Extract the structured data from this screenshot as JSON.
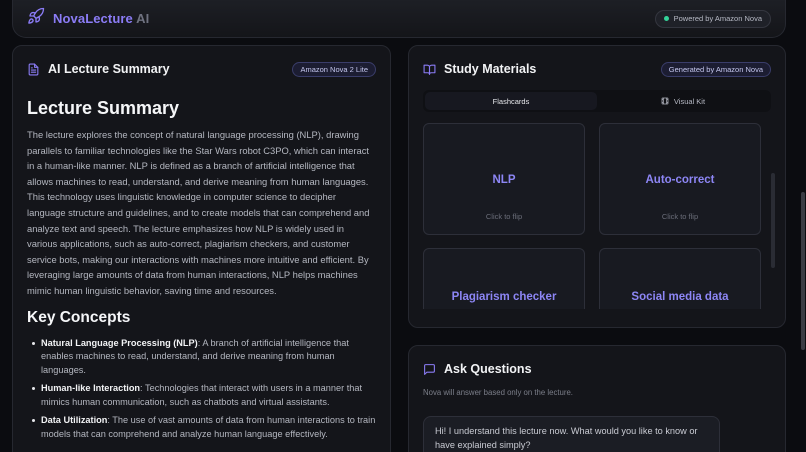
{
  "header": {
    "brand_name": "NovaLecture",
    "brand_suffix": "AI",
    "powered_label": "Powered by Amazon Nova",
    "rocket_icon": "rocket-icon",
    "accent_color": "#8b7cf6",
    "status_color": "#34d399"
  },
  "summary": {
    "panel_title": "AI Lecture Summary",
    "model_badge": "Amazon Nova 2 Lite",
    "heading": "Lecture Summary",
    "paragraph": "The lecture explores the concept of natural language processing (NLP), drawing parallels to familiar technologies like the Star Wars robot C3PO, which can interact in a human-like manner. NLP is defined as a branch of artificial intelligence that allows machines to read, understand, and derive meaning from human languages. This technology uses linguistic knowledge in computer science to decipher language structure and guidelines, and to create models that can comprehend and analyze text and speech. The lecture emphasizes how NLP is widely used in various applications, such as auto-correct, plagiarism checkers, and customer service bots, making our interactions with machines more intuitive and efficient. By leveraging large amounts of data from human interactions, NLP helps machines mimic human linguistic behavior, saving time and resources.",
    "concepts_heading": "Key Concepts",
    "concepts": [
      {
        "term": "Natural Language Processing (NLP)",
        "desc": ": A branch of artificial intelligence that enables machines to read, understand, and derive meaning from human languages."
      },
      {
        "term": "Human-like Interaction",
        "desc": ": Technologies that interact with users in a manner that mimics human communication, such as chatbots and virtual assistants."
      },
      {
        "term": "Data Utilization",
        "desc": ": The use of vast amounts of data from human interactions to train models that can comprehend and analyze human language effectively."
      }
    ]
  },
  "study": {
    "panel_title": "Study Materials",
    "badge": "Generated by Amazon Nova",
    "tabs": [
      {
        "label": "Flashcards",
        "active": true
      },
      {
        "label": "Visual Kit",
        "active": false
      }
    ],
    "flip_hint": "Click to flip",
    "cards": [
      {
        "term": "NLP"
      },
      {
        "term": "Auto-correct"
      },
      {
        "term": "Plagiarism checker"
      },
      {
        "term": "Social media data"
      }
    ]
  },
  "ask": {
    "panel_title": "Ask Questions",
    "subtitle": "Nova will answer based only on the lecture.",
    "assistant_message": "Hi! I understand this lecture now. What would you like to know or have explained simply?"
  }
}
